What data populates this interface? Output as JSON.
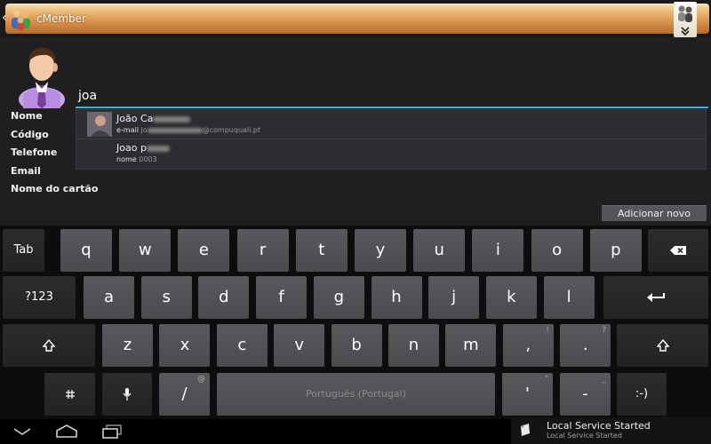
{
  "app": {
    "title": "cMember"
  },
  "icons": {
    "back": "chevron-left-icon",
    "logo": "people-group-icon",
    "menu": "overflow-menu-icon"
  },
  "form": {
    "labels": [
      "Nome",
      "Código",
      "Telefone",
      "Email",
      "Nome do cartão"
    ],
    "search_value": "joa",
    "add_button": "Adicionar novo"
  },
  "suggestions": [
    {
      "name": "João Ca",
      "sub_label": "e-mail",
      "sub_value_prefix": "jo",
      "sub_value_suffix": "@compuquali.pt"
    },
    {
      "name": "Joao p",
      "sub_label": "nome",
      "sub_value": "0003"
    }
  ],
  "keyboard": {
    "row1": [
      "q",
      "w",
      "e",
      "r",
      "t",
      "y",
      "u",
      "i",
      "o",
      "p"
    ],
    "row2": [
      "a",
      "s",
      "d",
      "f",
      "g",
      "h",
      "j",
      "k",
      "l"
    ],
    "row3": [
      "z",
      "x",
      "c",
      "v",
      "b",
      "n",
      "m",
      ",",
      "."
    ],
    "row3_hints": {
      "7": "!",
      "8": "?"
    },
    "tab": "Tab",
    "numeric": "?123",
    "slash": "/",
    "slash_hint": "@",
    "space_label": "Português (Portugal)",
    "apostrophe": "'",
    "apostrophe_hint": "\"",
    "dash": "-",
    "dash_hint": "_",
    "smiley": ":-)"
  },
  "notification": {
    "title": "Local Service Started",
    "subtitle": "Local Service Started"
  },
  "colors": {
    "accent": "#33b5e5",
    "titlebar_top": "#f4e0b2",
    "titlebar_bottom": "#b86a2a",
    "key": "#525356"
  }
}
